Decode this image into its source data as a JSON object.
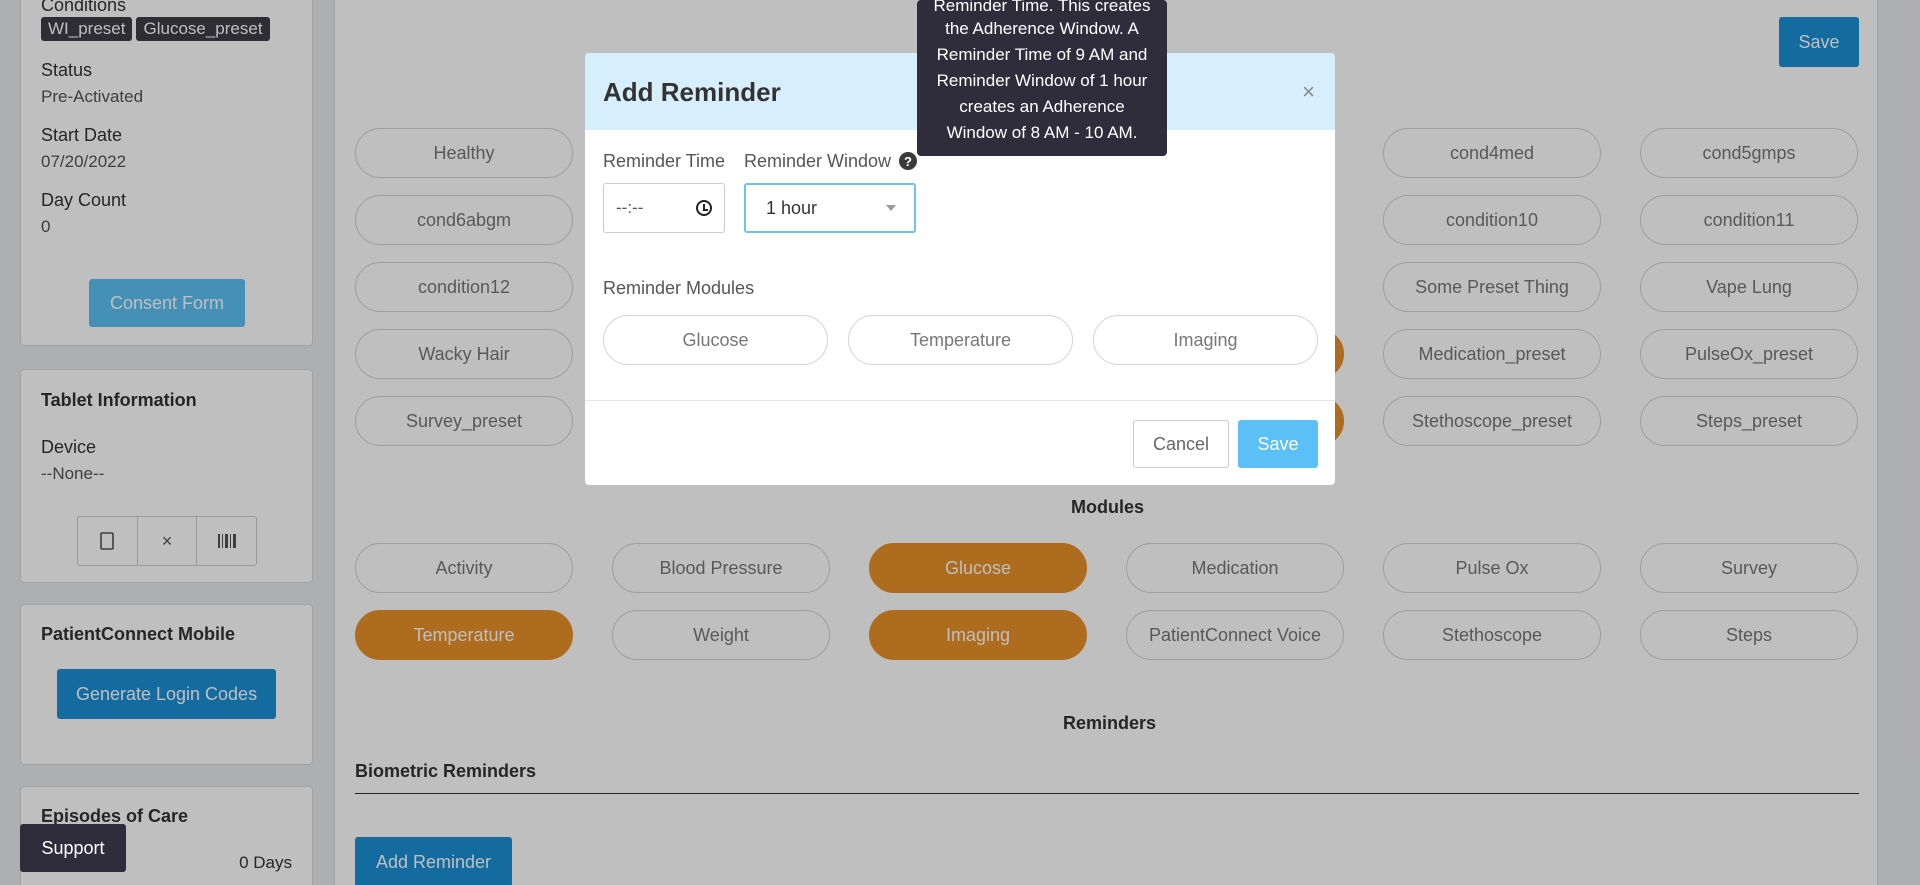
{
  "patient": {
    "conditions_label": "Conditions",
    "condition_tags": [
      "WI_preset",
      "Glucose_preset"
    ],
    "status_label": "Status",
    "status_value": "Pre-Activated",
    "start_date_label": "Start Date",
    "start_date_value": "07/20/2022",
    "day_count_label": "Day Count",
    "day_count_value": "0",
    "consent_button": "Consent Form"
  },
  "tablet": {
    "title": "Tablet Information",
    "device_label": "Device",
    "device_value": "--None--",
    "icons": [
      "tablet-icon",
      "close-icon",
      "barcode-icon"
    ]
  },
  "mobile": {
    "title": "PatientConnect Mobile",
    "generate_button": "Generate Login Codes"
  },
  "episodes": {
    "title": "Episodes of Care",
    "days": "0 Days"
  },
  "support_label": "Support",
  "main": {
    "save_label": "Save",
    "conditions": [
      {
        "label": "Healthy",
        "active": false
      },
      {
        "label": "cond4med",
        "active": false
      },
      {
        "label": "cond5gmps",
        "active": false
      },
      {
        "label": "cond6abgm",
        "active": false
      },
      {
        "label": "condition10",
        "active": false
      },
      {
        "label": "condition11",
        "active": false
      },
      {
        "label": "condition12",
        "active": false
      },
      {
        "label": "Some Preset Thing",
        "active": false
      },
      {
        "label": "Vape Lung",
        "active": false
      },
      {
        "label": "Wacky Hair",
        "active": false
      },
      {
        "label": "Medication_preset",
        "active": false
      },
      {
        "label": "PulseOx_preset",
        "active": false
      },
      {
        "label": "Survey_preset",
        "active": false
      },
      {
        "label": "Stethoscope_preset",
        "active": false
      },
      {
        "label": "Steps_preset",
        "active": false
      }
    ],
    "modules_title": "Modules",
    "modules": [
      {
        "label": "Activity",
        "active": false
      },
      {
        "label": "Blood Pressure",
        "active": false
      },
      {
        "label": "Glucose",
        "active": true
      },
      {
        "label": "Medication",
        "active": false
      },
      {
        "label": "Pulse Ox",
        "active": false
      },
      {
        "label": "Survey",
        "active": false
      },
      {
        "label": "Temperature",
        "active": true
      },
      {
        "label": "Weight",
        "active": false
      },
      {
        "label": "Imaging",
        "active": true
      },
      {
        "label": "PatientConnect Voice",
        "active": false
      },
      {
        "label": "Stethoscope",
        "active": false
      },
      {
        "label": "Steps",
        "active": false
      }
    ],
    "reminders_title": "Reminders",
    "biometric_title": "Biometric Reminders",
    "add_reminder_button": "Add Reminder",
    "active_color": "#e89028"
  },
  "modal": {
    "title": "Add Reminder",
    "close_symbol": "×",
    "reminder_time_label": "Reminder Time",
    "time_value": "--:--",
    "reminder_window_label": "Reminder Window",
    "window_value": "1 hour",
    "help_symbol": "?",
    "modules_label": "Reminder Modules",
    "modules": [
      "Glucose",
      "Temperature",
      "Imaging"
    ],
    "cancel_label": "Cancel",
    "save_label": "Save"
  },
  "tooltip": {
    "lines": [
      "Reminder Time. This creates",
      "the Adherence Window. A",
      "Reminder Time of 9 AM and",
      "Reminder Window of 1 hour",
      "creates an Adherence",
      "Window of 8 AM - 10 AM."
    ]
  }
}
